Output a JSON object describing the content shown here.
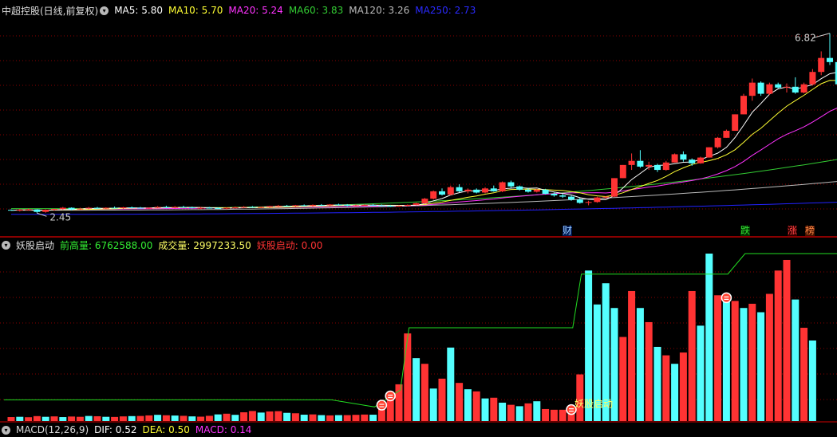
{
  "price_header": {
    "title": "中超控股(日线,前复权)",
    "ma5": "MA5: 5.80",
    "ma10": "MA10: 5.70",
    "ma20": "MA20: 5.24",
    "ma60": "MA60: 3.83",
    "ma120": "MA120: 3.26",
    "ma250": "MA250: 2.73",
    "colors": {
      "ma5": "#ffffff",
      "ma10": "#ffff33",
      "ma20": "#ff33ff",
      "ma60": "#33cc33",
      "ma120": "#bbbbbb",
      "ma250": "#2222ff"
    }
  },
  "price_labels": {
    "high": "6.82",
    "low": "2.45"
  },
  "events": [
    {
      "text": "财",
      "color": "#9ecfff",
      "bg": "#001a55"
    },
    {
      "text": "跌",
      "color": "#33dd33",
      "bg": "#003300"
    },
    {
      "text": "涨",
      "color": "#ff4444",
      "bg": "#330000"
    },
    {
      "text": "榜",
      "color": "#ff8844",
      "bg": "#441100"
    }
  ],
  "indicator_header": {
    "title": "妖股启动",
    "prev_high": "前高量: 6762588.00",
    "volume": "成交量: 2997233.50",
    "signal": "妖股启动: 0.00"
  },
  "signal_label": "妖股启动",
  "macd_header": {
    "title": "MACD(12,26,9)",
    "dif": "DIF: 0.52",
    "dea": "DEA: 0.50",
    "macd": "MACD: 0.14"
  },
  "colors": {
    "up": "#ff3333",
    "down": "#54ffff",
    "grid": "#8a0000"
  },
  "chart_data": {
    "type": "candlestick",
    "title": "中超控股(日线,前复权)",
    "price_range": [
      2.45,
      6.82
    ],
    "candles": [
      [
        2.53,
        2.54,
        2.51,
        2.52
      ],
      [
        2.52,
        2.55,
        2.49,
        2.53
      ],
      [
        2.53,
        2.56,
        2.51,
        2.54
      ],
      [
        2.54,
        2.55,
        2.45,
        2.48
      ],
      [
        2.48,
        2.54,
        2.46,
        2.53
      ],
      [
        2.53,
        2.56,
        2.51,
        2.55
      ],
      [
        2.55,
        2.6,
        2.53,
        2.58
      ],
      [
        2.58,
        2.59,
        2.52,
        2.54
      ],
      [
        2.54,
        2.58,
        2.53,
        2.56
      ],
      [
        2.56,
        2.6,
        2.54,
        2.58
      ],
      [
        2.58,
        2.6,
        2.55,
        2.57
      ],
      [
        2.57,
        2.59,
        2.55,
        2.58
      ],
      [
        2.58,
        2.61,
        2.56,
        2.57
      ],
      [
        2.57,
        2.6,
        2.55,
        2.59
      ],
      [
        2.59,
        2.61,
        2.56,
        2.58
      ],
      [
        2.58,
        2.6,
        2.56,
        2.57
      ],
      [
        2.57,
        2.59,
        2.55,
        2.58
      ],
      [
        2.58,
        2.62,
        2.57,
        2.6
      ],
      [
        2.6,
        2.63,
        2.57,
        2.58
      ],
      [
        2.58,
        2.62,
        2.56,
        2.6
      ],
      [
        2.6,
        2.63,
        2.58,
        2.59
      ],
      [
        2.59,
        2.61,
        2.56,
        2.57
      ],
      [
        2.57,
        2.6,
        2.55,
        2.58
      ],
      [
        2.58,
        2.6,
        2.56,
        2.57
      ],
      [
        2.57,
        2.59,
        2.55,
        2.56
      ],
      [
        2.56,
        2.59,
        2.54,
        2.58
      ],
      [
        2.58,
        2.61,
        2.56,
        2.59
      ],
      [
        2.59,
        2.62,
        2.57,
        2.6
      ],
      [
        2.6,
        2.62,
        2.58,
        2.59
      ],
      [
        2.59,
        2.61,
        2.57,
        2.6
      ],
      [
        2.6,
        2.63,
        2.58,
        2.62
      ],
      [
        2.62,
        2.65,
        2.6,
        2.63
      ],
      [
        2.63,
        2.65,
        2.61,
        2.62
      ],
      [
        2.62,
        2.65,
        2.6,
        2.64
      ],
      [
        2.64,
        2.66,
        2.61,
        2.63
      ],
      [
        2.63,
        2.66,
        2.61,
        2.65
      ],
      [
        2.65,
        2.67,
        2.62,
        2.64
      ],
      [
        2.64,
        2.67,
        2.62,
        2.66
      ],
      [
        2.66,
        2.68,
        2.63,
        2.65
      ],
      [
        2.65,
        2.67,
        2.61,
        2.63
      ],
      [
        2.63,
        2.66,
        2.61,
        2.64
      ],
      [
        2.64,
        2.66,
        2.62,
        2.65
      ],
      [
        2.65,
        2.67,
        2.63,
        2.64
      ],
      [
        2.64,
        2.66,
        2.62,
        2.63
      ],
      [
        2.63,
        2.65,
        2.6,
        2.62
      ],
      [
        2.62,
        2.64,
        2.6,
        2.63
      ],
      [
        2.63,
        2.66,
        2.61,
        2.65
      ],
      [
        2.65,
        2.7,
        2.64,
        2.69
      ],
      [
        2.69,
        2.82,
        2.67,
        2.8
      ],
      [
        2.8,
        3.0,
        2.78,
        2.98
      ],
      [
        2.98,
        3.05,
        2.88,
        2.9
      ],
      [
        2.9,
        3.12,
        2.88,
        3.08
      ],
      [
        3.08,
        3.15,
        2.96,
        2.98
      ],
      [
        2.98,
        3.05,
        2.93,
        3.02
      ],
      [
        3.02,
        3.05,
        2.93,
        2.95
      ],
      [
        2.95,
        3.08,
        2.93,
        3.05
      ],
      [
        3.05,
        3.12,
        2.97,
        2.98
      ],
      [
        2.98,
        3.22,
        2.96,
        3.2
      ],
      [
        3.2,
        3.24,
        3.06,
        3.1
      ],
      [
        3.1,
        3.12,
        3.0,
        3.02
      ],
      [
        3.02,
        3.06,
        2.95,
        2.97
      ],
      [
        2.97,
        3.04,
        2.95,
        3.02
      ],
      [
        3.02,
        3.04,
        2.9,
        2.92
      ],
      [
        2.92,
        2.95,
        2.85,
        2.88
      ],
      [
        2.88,
        2.92,
        2.82,
        2.85
      ],
      [
        2.85,
        2.88,
        2.75,
        2.78
      ],
      [
        2.78,
        2.82,
        2.68,
        2.7
      ],
      [
        2.7,
        2.75,
        2.64,
        2.72
      ],
      [
        2.72,
        2.85,
        2.7,
        2.83
      ],
      [
        2.83,
        2.86,
        2.8,
        2.85
      ],
      [
        2.85,
        3.3,
        2.84,
        3.3
      ],
      [
        3.3,
        3.62,
        3.3,
        3.62
      ],
      [
        3.62,
        3.9,
        3.5,
        3.72
      ],
      [
        3.72,
        3.98,
        3.55,
        3.58
      ],
      [
        3.58,
        3.7,
        3.5,
        3.62
      ],
      [
        3.62,
        3.65,
        3.45,
        3.5
      ],
      [
        3.5,
        3.72,
        3.48,
        3.68
      ],
      [
        3.68,
        3.9,
        3.68,
        3.88
      ],
      [
        3.88,
        3.95,
        3.7,
        3.75
      ],
      [
        3.75,
        3.78,
        3.6,
        3.66
      ],
      [
        3.66,
        3.82,
        3.65,
        3.8
      ],
      [
        3.8,
        4.05,
        3.8,
        4.05
      ],
      [
        4.05,
        4.3,
        4.02,
        4.28
      ],
      [
        4.28,
        4.48,
        4.28,
        4.45
      ],
      [
        4.45,
        4.85,
        4.45,
        4.85
      ],
      [
        4.85,
        5.35,
        4.85,
        5.3
      ],
      [
        5.3,
        5.72,
        5.18,
        5.62
      ],
      [
        5.62,
        5.65,
        5.3,
        5.35
      ],
      [
        5.35,
        5.62,
        5.32,
        5.58
      ],
      [
        5.58,
        5.62,
        5.48,
        5.5
      ],
      [
        5.5,
        5.6,
        5.38,
        5.52
      ],
      [
        5.52,
        5.75,
        5.35,
        5.38
      ],
      [
        5.38,
        5.62,
        5.36,
        5.58
      ],
      [
        5.58,
        5.95,
        5.55,
        5.88
      ],
      [
        5.88,
        6.38,
        5.8,
        6.22
      ],
      [
        6.22,
        6.82,
        6.05,
        6.12
      ],
      [
        6.12,
        6.15,
        5.45,
        5.58
      ],
      [
        5.58,
        5.65,
        5.32,
        5.42
      ],
      [
        5.42,
        5.48,
        5.22,
        5.3
      ]
    ],
    "volume": [
      [
        0.28,
        "up"
      ],
      [
        0.3,
        "down"
      ],
      [
        0.27,
        "up"
      ],
      [
        0.35,
        "up"
      ],
      [
        0.3,
        "down"
      ],
      [
        0.33,
        "up"
      ],
      [
        0.28,
        "down"
      ],
      [
        0.32,
        "up"
      ],
      [
        0.3,
        "up"
      ],
      [
        0.36,
        "down"
      ],
      [
        0.34,
        "up"
      ],
      [
        0.3,
        "down"
      ],
      [
        0.29,
        "up"
      ],
      [
        0.33,
        "up"
      ],
      [
        0.35,
        "down"
      ],
      [
        0.36,
        "up"
      ],
      [
        0.4,
        "up"
      ],
      [
        0.44,
        "down"
      ],
      [
        0.41,
        "up"
      ],
      [
        0.39,
        "down"
      ],
      [
        0.37,
        "up"
      ],
      [
        0.33,
        "down"
      ],
      [
        0.31,
        "up"
      ],
      [
        0.37,
        "up"
      ],
      [
        0.47,
        "down"
      ],
      [
        0.52,
        "up"
      ],
      [
        0.44,
        "down"
      ],
      [
        0.62,
        "up"
      ],
      [
        0.71,
        "up"
      ],
      [
        0.6,
        "down"
      ],
      [
        0.68,
        "up"
      ],
      [
        0.7,
        "up"
      ],
      [
        0.58,
        "down"
      ],
      [
        0.55,
        "up"
      ],
      [
        0.45,
        "down"
      ],
      [
        0.47,
        "up"
      ],
      [
        0.42,
        "down"
      ],
      [
        0.4,
        "up"
      ],
      [
        0.42,
        "down"
      ],
      [
        0.42,
        "up"
      ],
      [
        0.44,
        "up"
      ],
      [
        0.46,
        "up"
      ],
      [
        0.45,
        "down"
      ],
      [
        0.9,
        "up"
      ],
      [
        1.55,
        "up"
      ],
      [
        2.6,
        "up"
      ],
      [
        6.2,
        "up"
      ],
      [
        4.45,
        "down"
      ],
      [
        4.05,
        "up"
      ],
      [
        2.3,
        "down"
      ],
      [
        3.0,
        "up"
      ],
      [
        5.2,
        "down"
      ],
      [
        2.7,
        "up"
      ],
      [
        2.25,
        "down"
      ],
      [
        2.1,
        "up"
      ],
      [
        1.6,
        "down"
      ],
      [
        1.65,
        "up"
      ],
      [
        1.3,
        "down"
      ],
      [
        1.15,
        "up"
      ],
      [
        1.05,
        "down"
      ],
      [
        1.25,
        "up"
      ],
      [
        1.4,
        "down"
      ],
      [
        0.85,
        "up"
      ],
      [
        0.8,
        "up"
      ],
      [
        0.8,
        "up"
      ],
      [
        0.7,
        "up"
      ],
      [
        3.3,
        "up"
      ],
      [
        10.65,
        "down"
      ],
      [
        8.25,
        "down"
      ],
      [
        9.75,
        "down"
      ],
      [
        8.0,
        "down"
      ],
      [
        5.95,
        "up"
      ],
      [
        9.2,
        "up"
      ],
      [
        8.0,
        "down"
      ],
      [
        7.0,
        "up"
      ],
      [
        5.25,
        "down"
      ],
      [
        4.65,
        "up"
      ],
      [
        4.05,
        "down"
      ],
      [
        4.85,
        "up"
      ],
      [
        9.2,
        "up"
      ],
      [
        6.75,
        "down"
      ],
      [
        11.85,
        "down"
      ],
      [
        8.9,
        "up"
      ],
      [
        8.5,
        "down"
      ],
      [
        8.5,
        "up"
      ],
      [
        8.0,
        "down"
      ],
      [
        8.3,
        "up"
      ],
      [
        7.7,
        "down"
      ],
      [
        9.0,
        "up"
      ],
      [
        10.65,
        "up"
      ],
      [
        11.4,
        "up"
      ],
      [
        8.6,
        "down"
      ],
      [
        6.6,
        "up"
      ],
      [
        5.7,
        "down"
      ]
    ],
    "prev_high_volume_level": [
      [
        0,
        1.5
      ],
      [
        38,
        1.5
      ],
      [
        43,
        1.0
      ],
      [
        46,
        2.2
      ],
      [
        47,
        6.6
      ],
      [
        66,
        6.6
      ],
      [
        67,
        10.4
      ],
      [
        84,
        10.4
      ],
      [
        86,
        11.85
      ],
      [
        97,
        11.85
      ]
    ],
    "signal_bars": [
      43,
      44,
      65,
      83
    ],
    "volume_range": [
      0,
      11.85
    ]
  }
}
